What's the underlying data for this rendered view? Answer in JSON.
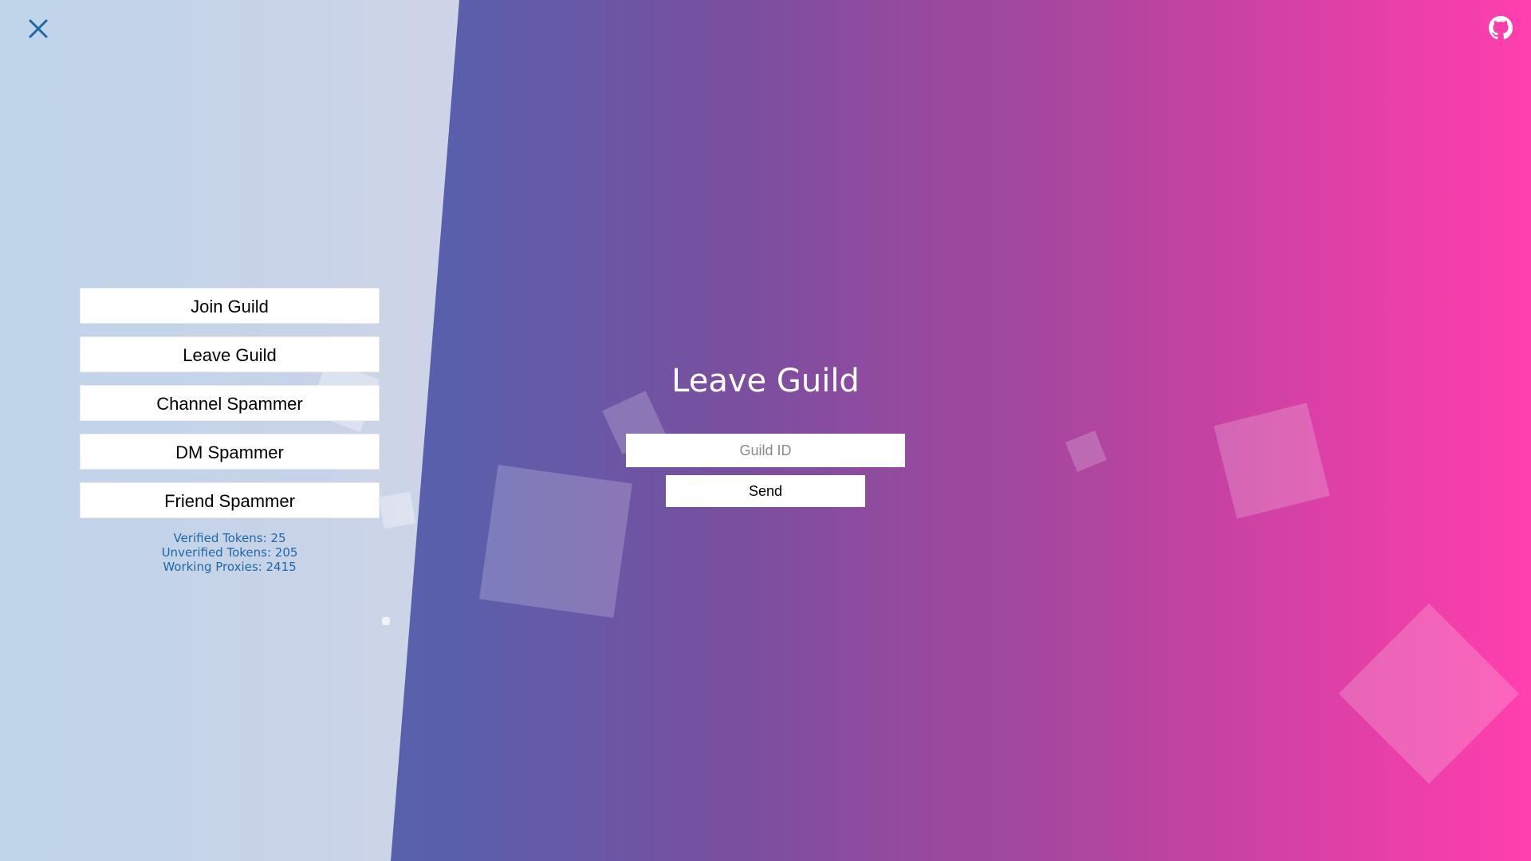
{
  "header": {
    "close_icon": "close-icon",
    "github_icon": "github-icon"
  },
  "sidebar": {
    "items": [
      {
        "label": "Join Guild"
      },
      {
        "label": "Leave Guild"
      },
      {
        "label": "Channel Spammer"
      },
      {
        "label": "DM Spammer"
      },
      {
        "label": "Friend Spammer"
      }
    ],
    "stats": {
      "verified": "Verified Tokens: 25",
      "unverified": "Unverified Tokens: 205",
      "proxies": "Working Proxies: 2415"
    }
  },
  "main": {
    "title": "Leave Guild",
    "guild_id_placeholder": "Guild ID",
    "guild_id_value": "",
    "send_label": "Send"
  },
  "colors": {
    "accent": "#1f67a8",
    "gradient_start": "#4f64b0",
    "gradient_end": "#ff3fae",
    "sidebar_bg": "#c7d3e7"
  }
}
